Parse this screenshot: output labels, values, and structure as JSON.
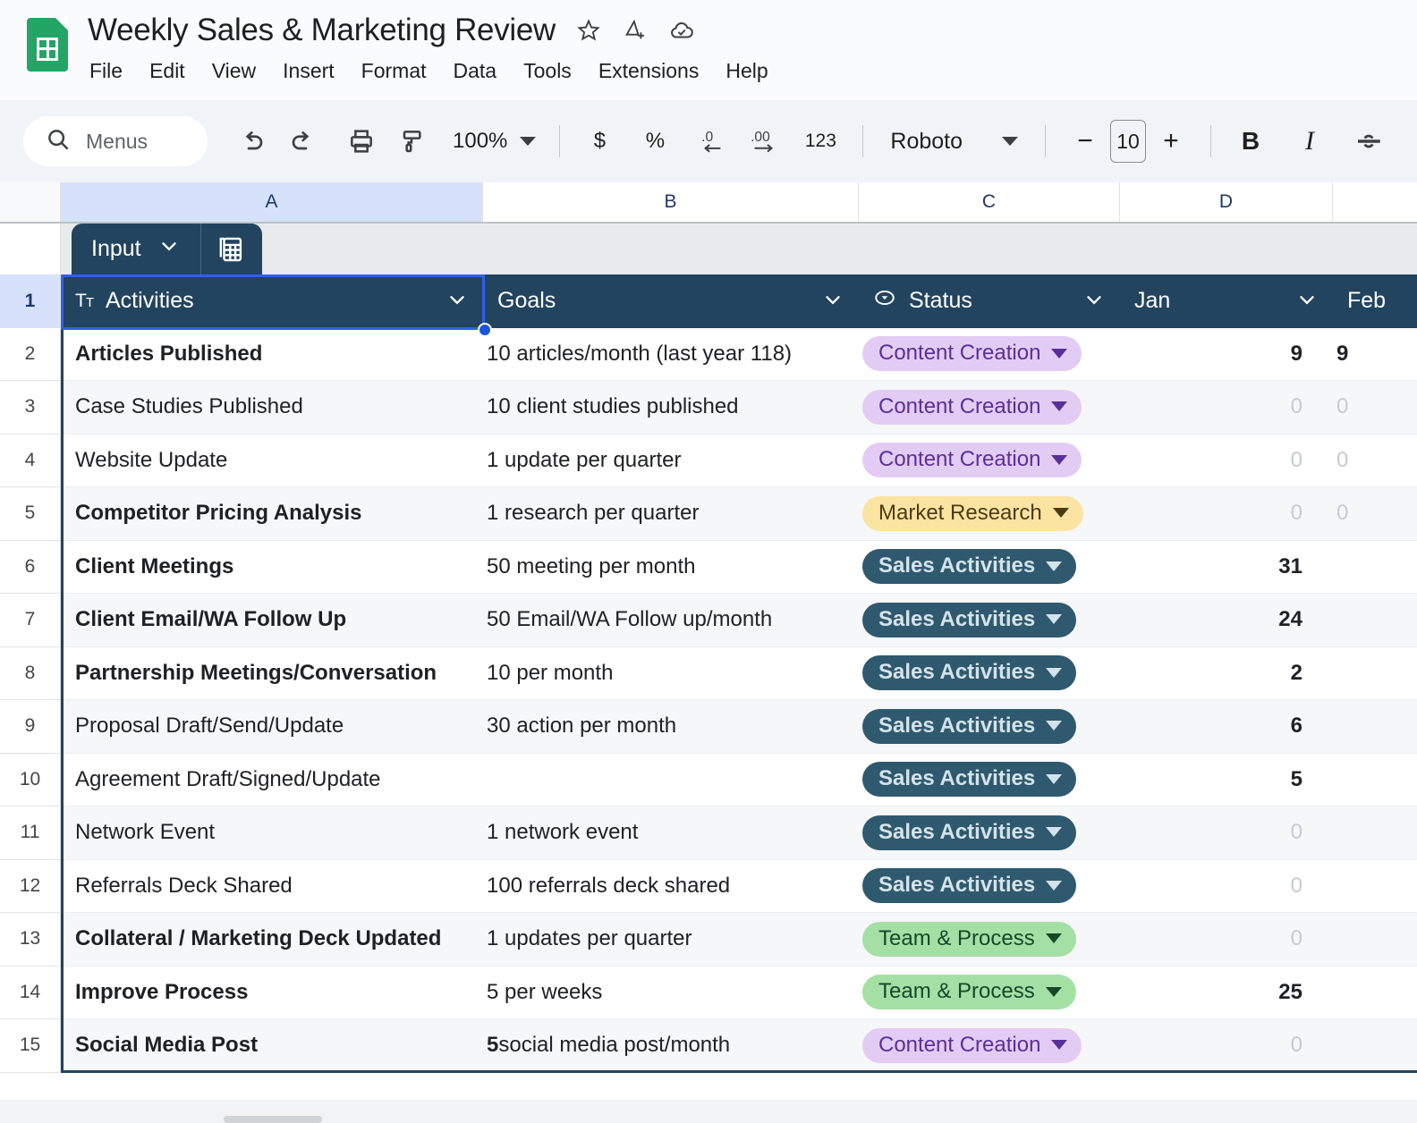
{
  "titlebar": {
    "doc_title": "Weekly Sales & Marketing Review",
    "icons": [
      {
        "name": "star-icon",
        "glyph": "☆"
      },
      {
        "name": "move-to-drive-icon",
        "glyph": "△"
      },
      {
        "name": "cloud-saved-icon",
        "glyph": "☁"
      }
    ],
    "menus": [
      "File",
      "Edit",
      "View",
      "Insert",
      "Format",
      "Data",
      "Tools",
      "Extensions",
      "Help"
    ]
  },
  "toolbar": {
    "search_placeholder": "Menus",
    "undo_label": "↶",
    "redo_label": "↷",
    "print_label": "⎙",
    "paint_label": "✐",
    "zoom_value": "100%",
    "currency_label": "$",
    "percent_label": "%",
    "dec_decimal_label": ".0",
    "inc_decimal_label": ".00",
    "number_format_label": "123",
    "font_name": "Roboto",
    "font_size_minus": "−",
    "font_size": "10",
    "font_size_plus": "+",
    "bold_label": "B",
    "italic_label": "I",
    "strikethrough_label": "S"
  },
  "grid": {
    "column_letters": [
      "A",
      "B",
      "C",
      "D"
    ],
    "selected_column": "A",
    "row_numbers": [
      "1",
      "2",
      "3",
      "4",
      "5",
      "6",
      "7",
      "8",
      "9",
      "10",
      "11",
      "12",
      "13",
      "14",
      "15"
    ],
    "selected_row": "1"
  },
  "table_chip": {
    "name_label": "Input",
    "chevron": "∨",
    "table_icon": "table-icon"
  },
  "table": {
    "headers": [
      {
        "label": "Activities",
        "icon": "text-format-icon",
        "icon_glyph": "Tᴛ",
        "chevron": "∨"
      },
      {
        "label": "Goals",
        "icon": null,
        "icon_glyph": "",
        "chevron": "∨"
      },
      {
        "label": "Status",
        "icon": "dropdown-chip-icon",
        "icon_glyph": "⊙",
        "chevron": "∨"
      },
      {
        "label": "Jan",
        "icon": null,
        "icon_glyph": "",
        "chevron": "∨"
      },
      {
        "label": "Feb",
        "icon": null,
        "icon_glyph": "",
        "chevron": ""
      }
    ],
    "status_styles": {
      "Content Creation": {
        "bg": "#e3ccf3",
        "fg": "#5a2f9a"
      },
      "Market Research": {
        "bg": "#fbe3a2",
        "fg": "#4a3b12"
      },
      "Sales Activities": {
        "bg": "#2f596e",
        "fg": "#d4e3ea"
      },
      "Team & Process": {
        "bg": "#a4e0a4",
        "fg": "#17472a"
      }
    },
    "rows": [
      {
        "row": "2",
        "activity": "Articles Published",
        "activity_bold": true,
        "goal": "10 articles/month (last year 118)",
        "goal_lead_bold": "",
        "status": "Content Creation",
        "jan": "9",
        "jan_zero": false,
        "feb": "9",
        "feb_zero": false
      },
      {
        "row": "3",
        "activity": "Case Studies Published",
        "activity_bold": false,
        "goal": "10 client studies published",
        "goal_lead_bold": "",
        "status": "Content Creation",
        "jan": "0",
        "jan_zero": true,
        "feb": "0",
        "feb_zero": true
      },
      {
        "row": "4",
        "activity": "Website Update",
        "activity_bold": false,
        "goal": "1 update per quarter",
        "goal_lead_bold": "",
        "status": "Content Creation",
        "jan": "0",
        "jan_zero": true,
        "feb": "0",
        "feb_zero": true
      },
      {
        "row": "5",
        "activity": "Competitor Pricing Analysis",
        "activity_bold": true,
        "goal": "1 research per quarter",
        "goal_lead_bold": "",
        "status": "Market Research",
        "jan": "0",
        "jan_zero": true,
        "feb": "0",
        "feb_zero": true
      },
      {
        "row": "6",
        "activity": "Client Meetings",
        "activity_bold": true,
        "goal": "50 meeting per month",
        "goal_lead_bold": "",
        "status": "Sales Activities",
        "jan": "31",
        "jan_zero": false,
        "feb": "",
        "feb_zero": false
      },
      {
        "row": "7",
        "activity": "Client Email/WA Follow Up",
        "activity_bold": true,
        "goal": "50 Email/WA Follow up/month",
        "goal_lead_bold": "",
        "status": "Sales Activities",
        "jan": "24",
        "jan_zero": false,
        "feb": "",
        "feb_zero": false
      },
      {
        "row": "8",
        "activity": "Partnership Meetings/Conversation",
        "activity_bold": true,
        "goal": "10 per month",
        "goal_lead_bold": "",
        "status": "Sales Activities",
        "jan": "2",
        "jan_zero": false,
        "feb": "",
        "feb_zero": false
      },
      {
        "row": "9",
        "activity": "Proposal Draft/Send/Update",
        "activity_bold": false,
        "goal": "30 action per month",
        "goal_lead_bold": "",
        "status": "Sales Activities",
        "jan": "6",
        "jan_zero": false,
        "feb": "",
        "feb_zero": false
      },
      {
        "row": "10",
        "activity": "Agreement Draft/Signed/Update",
        "activity_bold": false,
        "goal": "",
        "goal_lead_bold": "",
        "status": "Sales Activities",
        "jan": "5",
        "jan_zero": false,
        "feb": "",
        "feb_zero": false
      },
      {
        "row": "11",
        "activity": "Network Event",
        "activity_bold": false,
        "goal": "1 network event",
        "goal_lead_bold": "",
        "status": "Sales Activities",
        "jan": "0",
        "jan_zero": true,
        "feb": "",
        "feb_zero": false
      },
      {
        "row": "12",
        "activity": "Referrals Deck Shared",
        "activity_bold": false,
        "goal": "100 referrals deck shared",
        "goal_lead_bold": "",
        "status": "Sales Activities",
        "jan": "0",
        "jan_zero": true,
        "feb": "",
        "feb_zero": false
      },
      {
        "row": "13",
        "activity": "Collateral / Marketing Deck Updated",
        "activity_bold": true,
        "goal": "1 updates per quarter",
        "goal_lead_bold": "",
        "status": "Team & Process",
        "jan": "0",
        "jan_zero": true,
        "feb": "",
        "feb_zero": false
      },
      {
        "row": "14",
        "activity": "Improve Process",
        "activity_bold": true,
        "goal": "5 per weeks",
        "goal_lead_bold": "",
        "status": "Team & Process",
        "jan": "25",
        "jan_zero": false,
        "feb": "",
        "feb_zero": false
      },
      {
        "row": "15",
        "activity": "Social Media Post",
        "activity_bold": true,
        "goal": " social media post/month",
        "goal_lead_bold": "5",
        "status": "Content Creation",
        "jan": "0",
        "jan_zero": true,
        "feb": "",
        "feb_zero": false
      }
    ]
  },
  "colors": {
    "header_navy": "#22445f",
    "selection_blue": "#2d62e8",
    "column_selected": "#d6e2fb",
    "toolbar_bg": "#f0f4f9",
    "titlebar_bg": "#f9fbfd",
    "brand_green": "#23a566"
  }
}
